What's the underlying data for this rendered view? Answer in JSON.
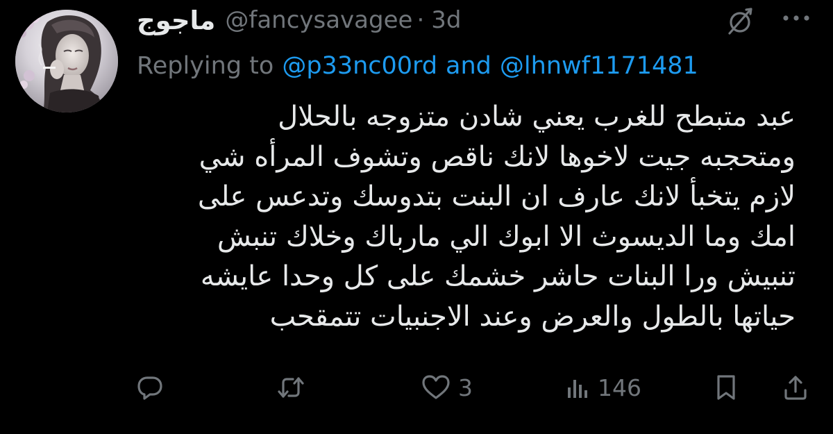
{
  "tweet": {
    "display_name": "ماجوج",
    "handle": "@fancysavagee",
    "separator": "·",
    "time": "3d",
    "replying_to_label": "Replying to",
    "reply_user_1": "@p33nc00rd",
    "reply_and": "and",
    "reply_user_2": "@lhnwf1171481",
    "text_lines": [
      "عبد متبطح للغرب يعني شادن متزوجه بالحلال",
      "ومتحجبه جيت لاخوها لانك ناقص وتشوف المرأه شي",
      "لازم يتخبأ لانك عارف ان البنت بتدوسك وتدعس على",
      "امك وما الديسوث الا ابوك الي مارباك وخلاك تنبش",
      "تنبيش ورا البنات حاشر خشمك على كل وحدا عايشه",
      "حياتها بالطول والعرض وعند الاجنبيات تتمقحب"
    ],
    "likes": "3",
    "views": "146"
  },
  "icons": {
    "grok": "grok-icon",
    "more": "more-icon",
    "reply": "reply-icon",
    "retweet": "retweet-icon",
    "like": "heart-icon",
    "views": "views-chart-icon",
    "bookmark": "bookmark-icon",
    "share": "share-icon"
  },
  "colors": {
    "background": "#000000",
    "primary_text": "#e7e9ea",
    "secondary_text": "#71767b",
    "link": "#1d9bf0"
  }
}
